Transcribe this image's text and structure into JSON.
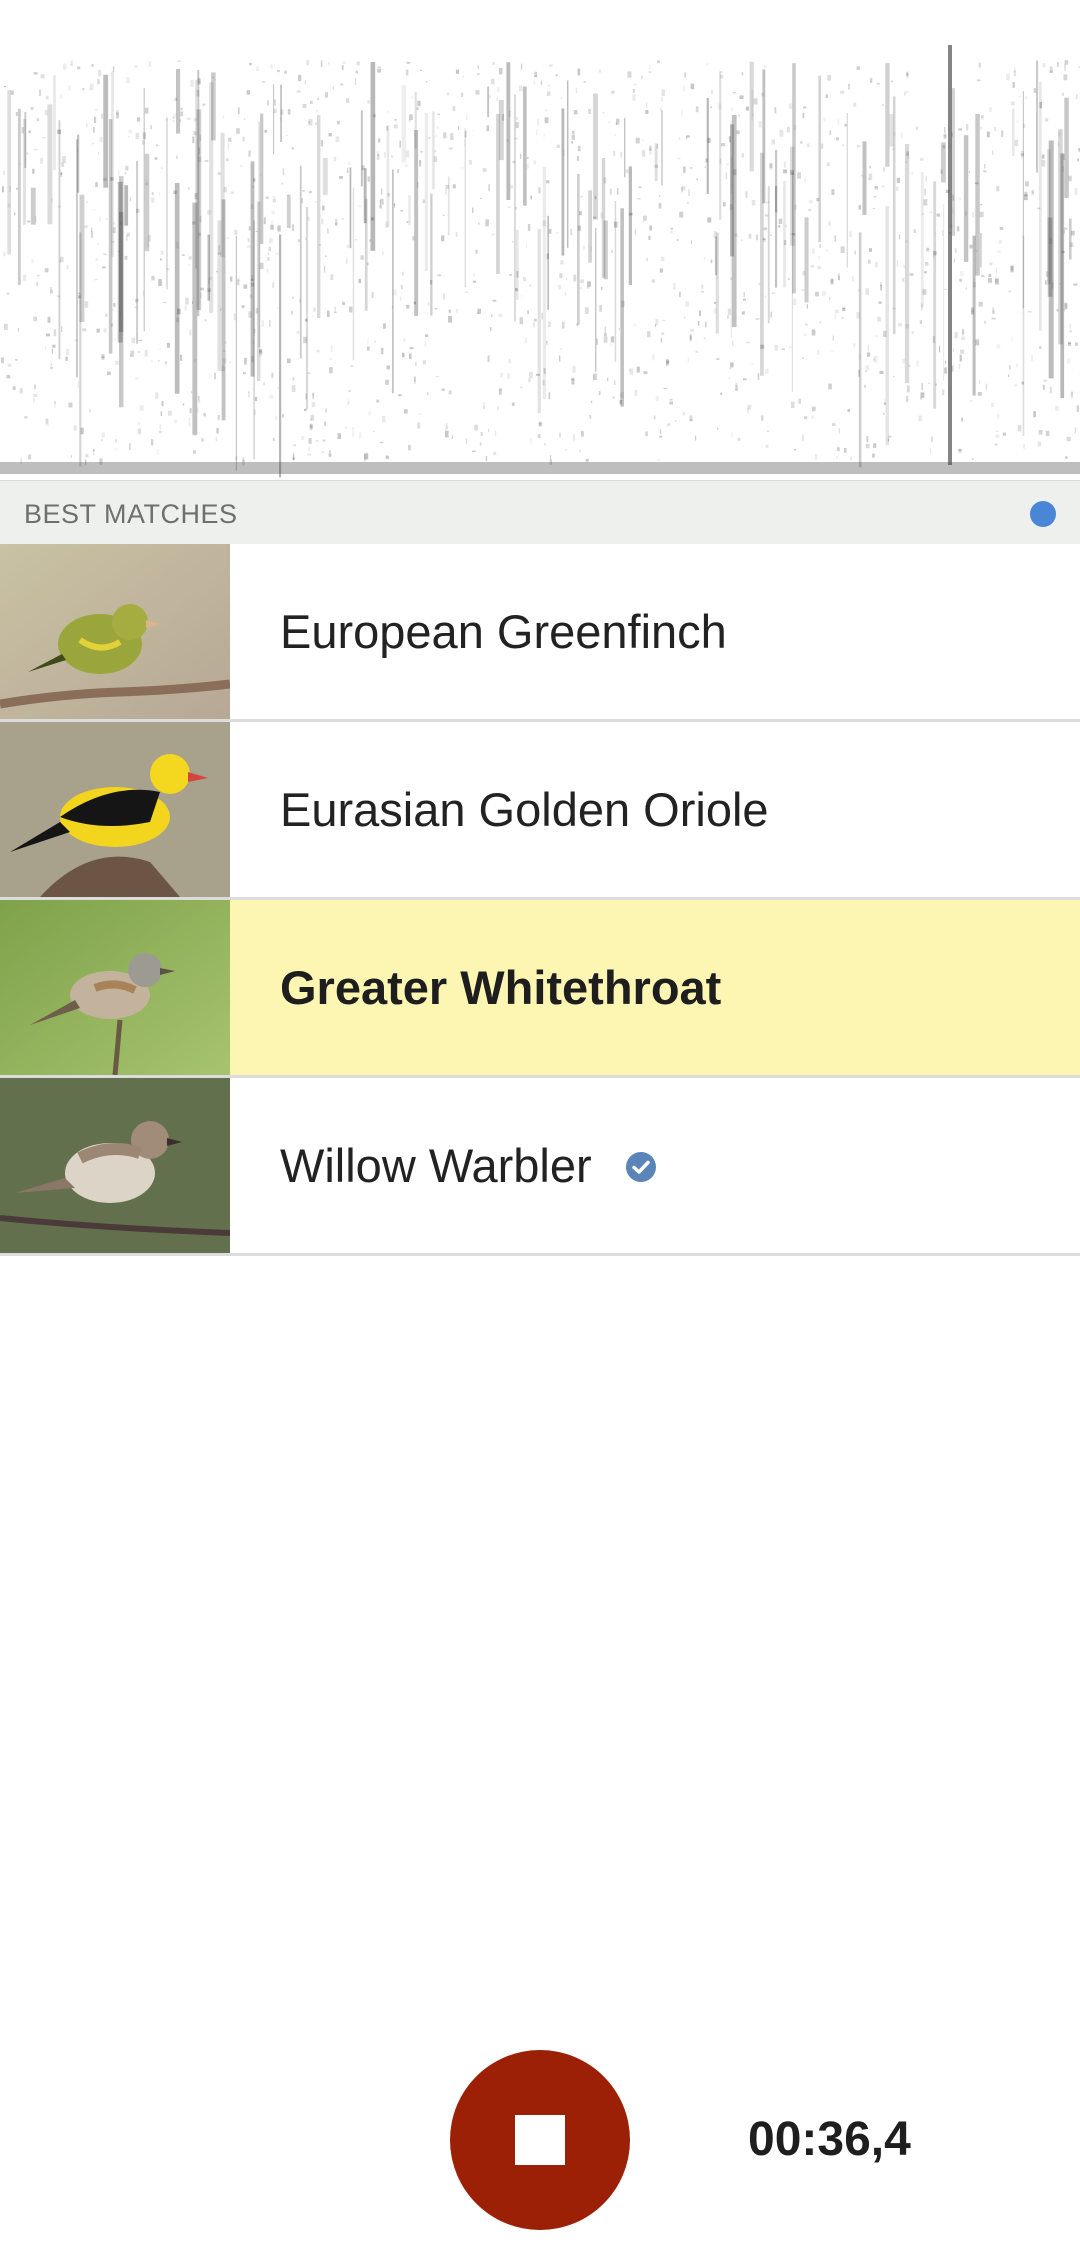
{
  "section": {
    "title": "BEST MATCHES",
    "indicator_color": "#4a86d6"
  },
  "matches": [
    {
      "name": "European Greenfinch",
      "highlighted": false,
      "verified": false,
      "thumbnail": "european-greenfinch-photo"
    },
    {
      "name": "Eurasian Golden Oriole",
      "highlighted": false,
      "verified": false,
      "thumbnail": "eurasian-golden-oriole-photo"
    },
    {
      "name": "Greater Whitethroat",
      "highlighted": true,
      "verified": false,
      "thumbnail": "greater-whitethroat-photo"
    },
    {
      "name": "Willow Warbler",
      "highlighted": false,
      "verified": true,
      "thumbnail": "willow-warbler-photo"
    }
  ],
  "recorder": {
    "elapsed_time": "00:36,4",
    "stop_icon": "stop-icon",
    "button_color": "#9b2005"
  },
  "colors": {
    "highlight": "#fdf6b3",
    "verified_badge": "#5b84b8"
  }
}
